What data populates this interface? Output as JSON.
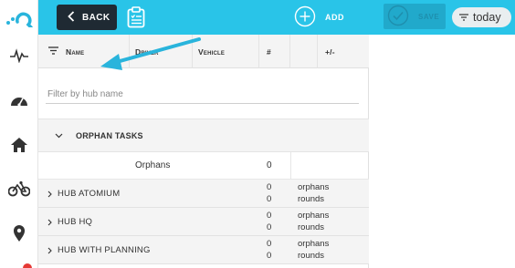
{
  "rail": {
    "icons": [
      "logo-icon",
      "activity-icon",
      "speedometer-icon",
      "home-icon",
      "bicycle-icon",
      "map-pin-icon"
    ]
  },
  "toolbar": {
    "back_label": "BACK",
    "add_label": "ADD",
    "save_label": "SAVE",
    "today_label": "today"
  },
  "table": {
    "columns": [
      {
        "label": "Name"
      },
      {
        "label": "Driver"
      },
      {
        "label": "Vehicle"
      },
      {
        "label": "#"
      },
      {
        "label": ""
      },
      {
        "label": "+/-"
      }
    ],
    "filter_placeholder": "Filter by hub name",
    "filter_value": ""
  },
  "orphan_group": {
    "label": "ORPHAN TASKS",
    "row": {
      "label": "Orphans",
      "count": "0"
    }
  },
  "hubs": [
    {
      "name": "HUB ATOMIUM",
      "orphans": "0",
      "rounds": "0",
      "orphans_label": "orphans",
      "rounds_label": "rounds"
    },
    {
      "name": "HUB HQ",
      "orphans": "0",
      "rounds": "0",
      "orphans_label": "orphans",
      "rounds_label": "rounds"
    },
    {
      "name": "HUB WITH PLANNING",
      "orphans": "0",
      "rounds": "0",
      "orphans_label": "orphans",
      "rounds_label": "rounds"
    }
  ],
  "colors": {
    "toolbar": "#29c4e8",
    "back_button": "#1f2a33",
    "save_button": "#21a9cb",
    "callout_arrow": "#29b4dc",
    "notification": "#e53935"
  }
}
